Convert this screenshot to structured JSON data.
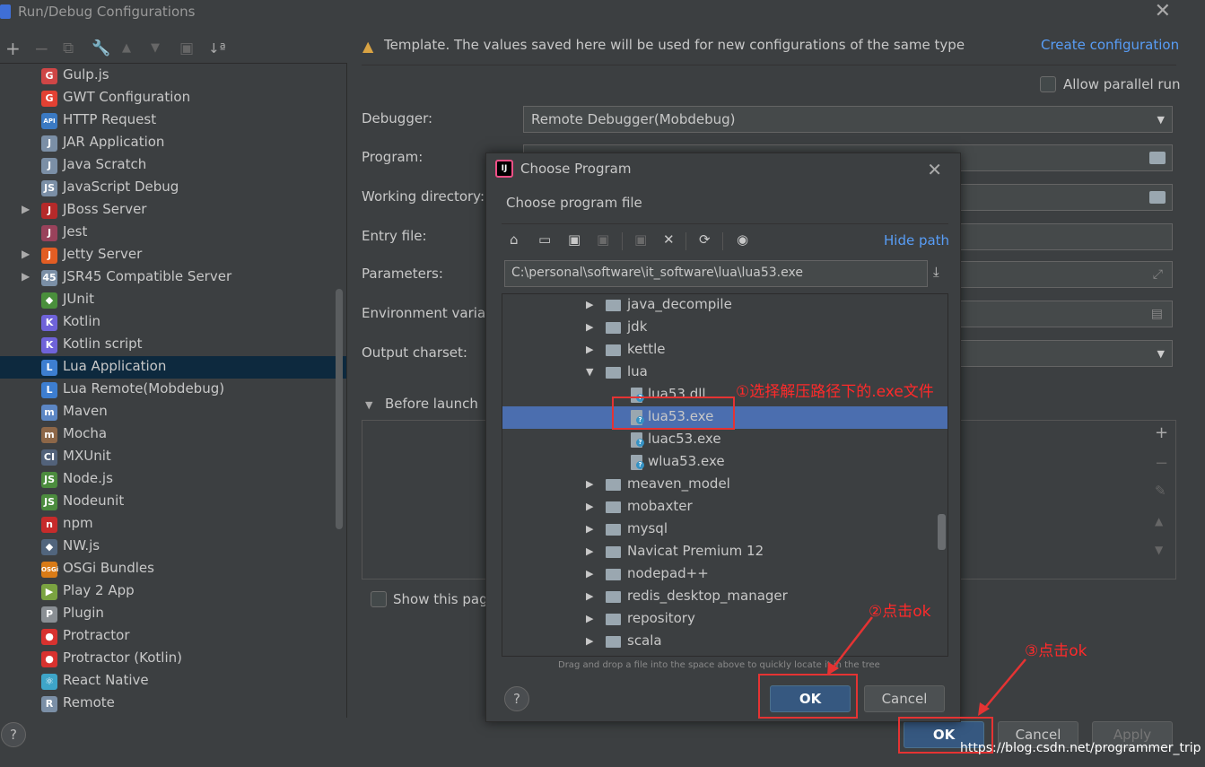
{
  "window": {
    "title": "Run/Debug Configurations",
    "close_icon": "close-icon"
  },
  "left_toolbar": {
    "add": "+",
    "remove": "−",
    "copy": "⧉",
    "edit": "🔧",
    "up": "▲",
    "down": "▼",
    "folder": "▣",
    "sort": "↓ª"
  },
  "config_tree": [
    {
      "label": "Gulp.js",
      "icon": "gulp-icon",
      "color": "#cf4646",
      "glyph": "G",
      "expandable": false
    },
    {
      "label": "GWT Configuration",
      "icon": "gwt-icon",
      "color": "#e34133",
      "glyph": "G",
      "expandable": false
    },
    {
      "label": "HTTP Request",
      "icon": "http-request-icon",
      "color": "#3b7ac3",
      "glyph": "API",
      "expandable": false
    },
    {
      "label": "JAR Application",
      "icon": "jar-icon",
      "color": "#7b8fa6",
      "glyph": "J",
      "expandable": false
    },
    {
      "label": "Java Scratch",
      "icon": "java-scratch-icon",
      "color": "#7b8fa6",
      "glyph": "J",
      "expandable": false
    },
    {
      "label": "JavaScript Debug",
      "icon": "js-debug-icon",
      "color": "#7b8fa6",
      "glyph": "JS",
      "expandable": false
    },
    {
      "label": "JBoss Server",
      "icon": "jboss-icon",
      "color": "#b52a2a",
      "glyph": "J",
      "expandable": true
    },
    {
      "label": "Jest",
      "icon": "jest-icon",
      "color": "#99425b",
      "glyph": "J",
      "expandable": false
    },
    {
      "label": "Jetty Server",
      "icon": "jetty-icon",
      "color": "#e25d23",
      "glyph": "J",
      "expandable": true
    },
    {
      "label": "JSR45 Compatible Server",
      "icon": "jsr45-icon",
      "color": "#7b8fa6",
      "glyph": "45",
      "expandable": true
    },
    {
      "label": "JUnit",
      "icon": "junit-icon",
      "color": "#4a8f3c",
      "glyph": "◆",
      "expandable": false
    },
    {
      "label": "Kotlin",
      "icon": "kotlin-icon",
      "color": "#6f63d9",
      "glyph": "K",
      "expandable": false
    },
    {
      "label": "Kotlin script",
      "icon": "kotlin-script-icon",
      "color": "#6f63d9",
      "glyph": "K",
      "expandable": false
    },
    {
      "label": "Lua Application",
      "icon": "lua-icon",
      "color": "#3d7ed0",
      "glyph": "L",
      "expandable": false,
      "selected": true
    },
    {
      "label": "Lua Remote(Mobdebug)",
      "icon": "lua-remote-icon",
      "color": "#3d7ed0",
      "glyph": "L",
      "expandable": false
    },
    {
      "label": "Maven",
      "icon": "maven-icon",
      "color": "#5c87c5",
      "glyph": "m",
      "expandable": false
    },
    {
      "label": "Mocha",
      "icon": "mocha-icon",
      "color": "#8d6748",
      "glyph": "m",
      "expandable": false
    },
    {
      "label": "MXUnit",
      "icon": "mxunit-icon",
      "color": "#52627a",
      "glyph": "CI",
      "expandable": false
    },
    {
      "label": "Node.js",
      "icon": "nodejs-icon",
      "color": "#4c8c3e",
      "glyph": "JS",
      "expandable": false
    },
    {
      "label": "Nodeunit",
      "icon": "nodeunit-icon",
      "color": "#4c8c3e",
      "glyph": "JS",
      "expandable": false
    },
    {
      "label": "npm",
      "icon": "npm-icon",
      "color": "#c62b2b",
      "glyph": "n",
      "expandable": false
    },
    {
      "label": "NW.js",
      "icon": "nwjs-icon",
      "color": "#51657d",
      "glyph": "◆",
      "expandable": false
    },
    {
      "label": "OSGi Bundles",
      "icon": "osgi-icon",
      "color": "#d97b17",
      "glyph": "OSGi",
      "expandable": false
    },
    {
      "label": "Play 2 App",
      "icon": "play-icon",
      "color": "#7aa341",
      "glyph": "▶",
      "expandable": false
    },
    {
      "label": "Plugin",
      "icon": "plugin-icon",
      "color": "#8a8f94",
      "glyph": "P",
      "expandable": false
    },
    {
      "label": "Protractor",
      "icon": "protractor-icon",
      "color": "#d8322f",
      "glyph": "●",
      "expandable": false
    },
    {
      "label": "Protractor (Kotlin)",
      "icon": "protractor-kotlin-icon",
      "color": "#d8322f",
      "glyph": "●",
      "expandable": false
    },
    {
      "label": "React Native",
      "icon": "react-native-icon",
      "color": "#3ea5c8",
      "glyph": "⚛",
      "expandable": false
    },
    {
      "label": "Remote",
      "icon": "remote-icon",
      "color": "#7b8fa6",
      "glyph": "R",
      "expandable": false
    }
  ],
  "right": {
    "template_notice": "Template. The values saved here will be used for new configurations of the same type",
    "create_configuration": "Create configuration",
    "allow_parallel_run": "Allow parallel run",
    "debugger_label": "Debugger:",
    "debugger_value": "Remote Debugger(Mobdebug)",
    "program_label": "Program:",
    "working_directory_label": "Working directory:",
    "entry_file_label": "Entry file:",
    "parameters_label": "Parameters:",
    "environment_label": "Environment variab",
    "output_charset_label": "Output charset:",
    "before_launch": "Before launch",
    "show_this_page": "Show this pag",
    "ok": "OK",
    "cancel": "Cancel",
    "apply": "Apply",
    "help": "?"
  },
  "dialog": {
    "title": "Choose Program",
    "subtitle": "Choose program file",
    "hide_path": "Hide path",
    "path_value": "C:\\personal\\software\\it_software\\lua\\lua53.exe",
    "drag_hint": "Drag and drop a file into the space above to quickly locate it in the tree",
    "ok": "OK",
    "cancel": "Cancel",
    "help": "?",
    "tree": [
      {
        "label": "java_decompile",
        "type": "folder",
        "level": 0,
        "expanded": false
      },
      {
        "label": "jdk",
        "type": "folder",
        "level": 0,
        "expanded": false
      },
      {
        "label": "kettle",
        "type": "folder",
        "level": 0,
        "expanded": false
      },
      {
        "label": "lua",
        "type": "folder",
        "level": 0,
        "expanded": true
      },
      {
        "label": "lua53.dll",
        "type": "file",
        "level": 1
      },
      {
        "label": "lua53.exe",
        "type": "file",
        "level": 1,
        "selected": true
      },
      {
        "label": "luac53.exe",
        "type": "file",
        "level": 1
      },
      {
        "label": "wlua53.exe",
        "type": "file",
        "level": 1
      },
      {
        "label": "meaven_model",
        "type": "folder",
        "level": 0,
        "expanded": false
      },
      {
        "label": "mobaxter",
        "type": "folder",
        "level": 0,
        "expanded": false
      },
      {
        "label": "mysql",
        "type": "folder",
        "level": 0,
        "expanded": false
      },
      {
        "label": "Navicat Premium 12",
        "type": "folder",
        "level": 0,
        "expanded": false
      },
      {
        "label": "nodepad++",
        "type": "folder",
        "level": 0,
        "expanded": false
      },
      {
        "label": "redis_desktop_manager",
        "type": "folder",
        "level": 0,
        "expanded": false
      },
      {
        "label": "repository",
        "type": "folder",
        "level": 0,
        "expanded": false
      },
      {
        "label": "scala",
        "type": "folder",
        "level": 0,
        "expanded": false
      }
    ]
  },
  "annotations": {
    "step1": "①选择解压路径下的.exe文件",
    "step2": "②点击ok",
    "step3": "③点击ok",
    "color": "#e53333"
  },
  "watermark": "https://blog.csdn.net/programmer_trip"
}
